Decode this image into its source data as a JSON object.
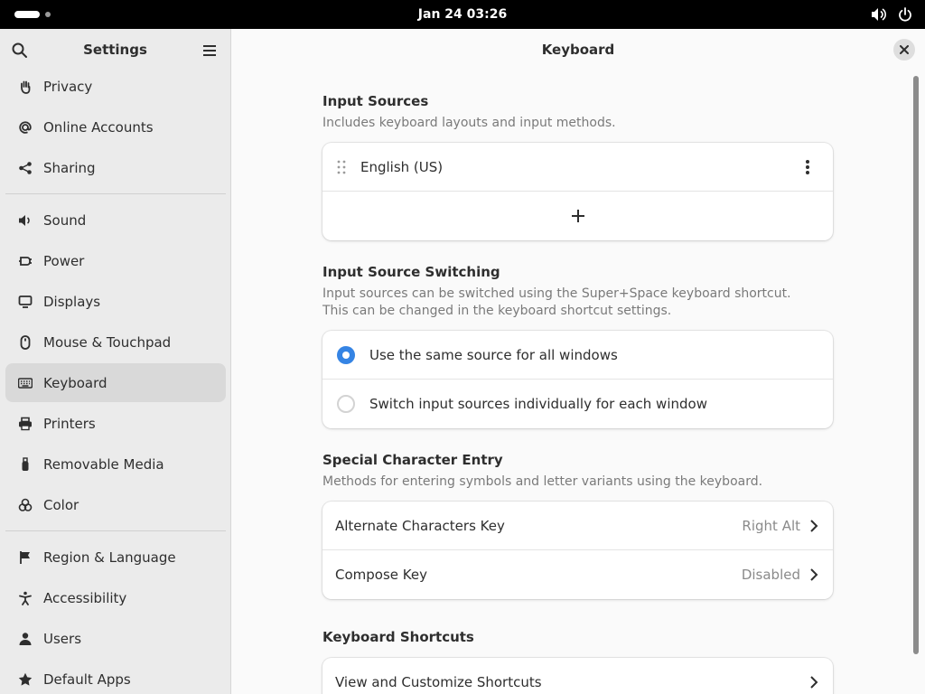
{
  "topbar": {
    "clock": "Jan 24  03:26"
  },
  "sidebar": {
    "title": "Settings",
    "items": [
      {
        "label": "Privacy",
        "icon": "hand-icon"
      },
      {
        "label": "Online Accounts",
        "icon": "at-icon"
      },
      {
        "label": "Sharing",
        "icon": "share-icon"
      },
      {
        "label": "Sound",
        "icon": "speaker-icon"
      },
      {
        "label": "Power",
        "icon": "power-plug-icon"
      },
      {
        "label": "Displays",
        "icon": "display-icon"
      },
      {
        "label": "Mouse & Touchpad",
        "icon": "mouse-icon"
      },
      {
        "label": "Keyboard",
        "icon": "keyboard-icon",
        "active": true
      },
      {
        "label": "Printers",
        "icon": "printer-icon"
      },
      {
        "label": "Removable Media",
        "icon": "usb-icon"
      },
      {
        "label": "Color",
        "icon": "color-icon"
      },
      {
        "label": "Region & Language",
        "icon": "flag-icon"
      },
      {
        "label": "Accessibility",
        "icon": "accessibility-icon"
      },
      {
        "label": "Users",
        "icon": "user-icon"
      },
      {
        "label": "Default Apps",
        "icon": "star-icon"
      }
    ]
  },
  "main": {
    "title": "Keyboard",
    "input_sources": {
      "title": "Input Sources",
      "description": "Includes keyboard layouts and input methods.",
      "sources": [
        "English (US)"
      ]
    },
    "switching": {
      "title": "Input Source Switching",
      "description_line1": "Input sources can be switched using the Super+Space keyboard shortcut.",
      "description_line2": "This can be changed in the keyboard shortcut settings.",
      "options": [
        {
          "label": "Use the same source for all windows",
          "selected": true
        },
        {
          "label": "Switch input sources individually for each window",
          "selected": false
        }
      ]
    },
    "special": {
      "title": "Special Character Entry",
      "description": "Methods for entering symbols and letter variants using the keyboard.",
      "rows": [
        {
          "label": "Alternate Characters Key",
          "value": "Right Alt"
        },
        {
          "label": "Compose Key",
          "value": "Disabled"
        }
      ]
    },
    "shortcuts": {
      "title": "Keyboard Shortcuts",
      "row_label": "View and Customize Shortcuts"
    }
  },
  "colors": {
    "accent": "#3584e4",
    "sidebar_bg": "#ebebeb",
    "active_item": "#d9d9d9"
  }
}
